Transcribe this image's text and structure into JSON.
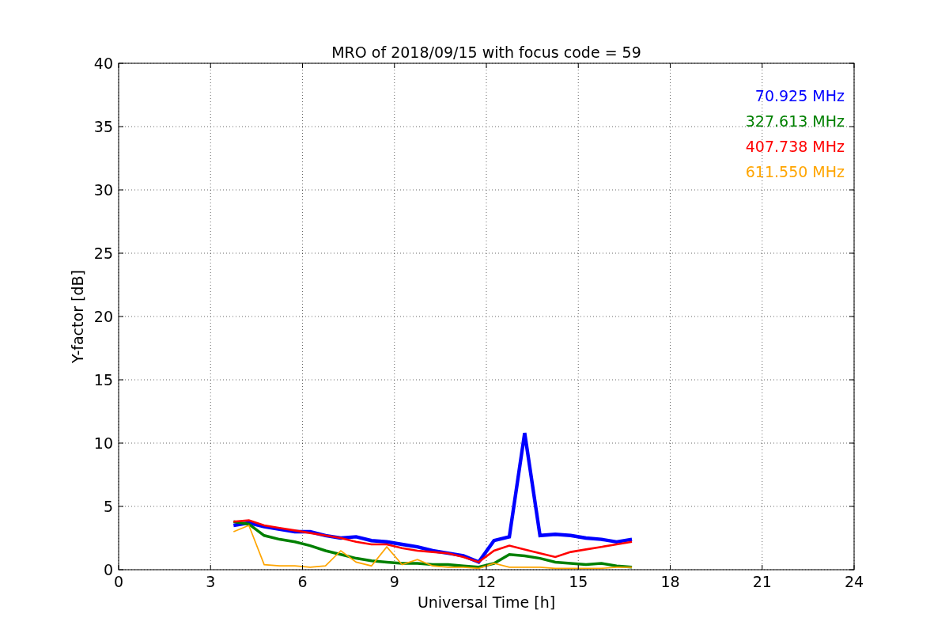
{
  "chart_data": {
    "type": "line",
    "title": "MRO of 2018/09/15 with focus code = 59",
    "xlabel": "Universal Time [h]",
    "ylabel": "Y-factor [dB]",
    "x": [
      3.75,
      4.25,
      4.75,
      5.25,
      5.75,
      6.25,
      6.75,
      7.25,
      7.75,
      8.25,
      8.75,
      9.25,
      9.75,
      10.25,
      10.75,
      11.25,
      11.75,
      12.25,
      12.75,
      13.25,
      13.75,
      14.25,
      14.75,
      15.25,
      15.75,
      16.25,
      16.75
    ],
    "series": [
      {
        "name": "70.925 MHz",
        "color": "#0000ff",
        "values": [
          3.5,
          3.7,
          3.4,
          3.2,
          3.0,
          3.0,
          2.7,
          2.5,
          2.6,
          2.3,
          2.2,
          2.0,
          1.8,
          1.5,
          1.3,
          1.1,
          0.6,
          2.3,
          2.6,
          10.8,
          2.7,
          2.8,
          2.7,
          2.5,
          2.4,
          2.2,
          2.4
        ]
      },
      {
        "name": "327.613 MHz",
        "color": "#008000",
        "values": [
          3.8,
          3.6,
          2.7,
          2.4,
          2.2,
          1.9,
          1.5,
          1.2,
          0.9,
          0.7,
          0.6,
          0.5,
          0.5,
          0.4,
          0.4,
          0.3,
          0.2,
          0.5,
          1.2,
          1.1,
          0.9,
          0.6,
          0.5,
          0.4,
          0.5,
          0.3,
          0.2
        ]
      },
      {
        "name": "407.738 MHz",
        "color": "#ff0000",
        "values": [
          3.8,
          3.9,
          3.5,
          3.3,
          3.1,
          2.9,
          2.7,
          2.5,
          2.2,
          2.0,
          2.0,
          1.7,
          1.5,
          1.4,
          1.3,
          1.0,
          0.6,
          1.5,
          1.9,
          1.6,
          1.3,
          1.0,
          1.4,
          1.6,
          1.8,
          2.0,
          2.2
        ]
      },
      {
        "name": "611.550 MHz",
        "color": "#ffa500",
        "values": [
          3.0,
          3.5,
          0.4,
          0.3,
          0.3,
          0.2,
          0.3,
          1.5,
          0.6,
          0.3,
          1.8,
          0.4,
          0.8,
          0.3,
          0.2,
          0.2,
          0.1,
          0.5,
          0.2,
          0.2,
          0.2,
          0.1,
          0.1,
          0.1,
          0.1,
          0.2,
          0.2
        ]
      }
    ],
    "xlim": [
      0,
      24
    ],
    "ylim": [
      0,
      40
    ],
    "xticks": [
      0,
      3,
      6,
      9,
      12,
      15,
      18,
      21,
      24
    ],
    "yticks": [
      0,
      5,
      10,
      15,
      20,
      25,
      30,
      35,
      40
    ],
    "grid": true
  }
}
